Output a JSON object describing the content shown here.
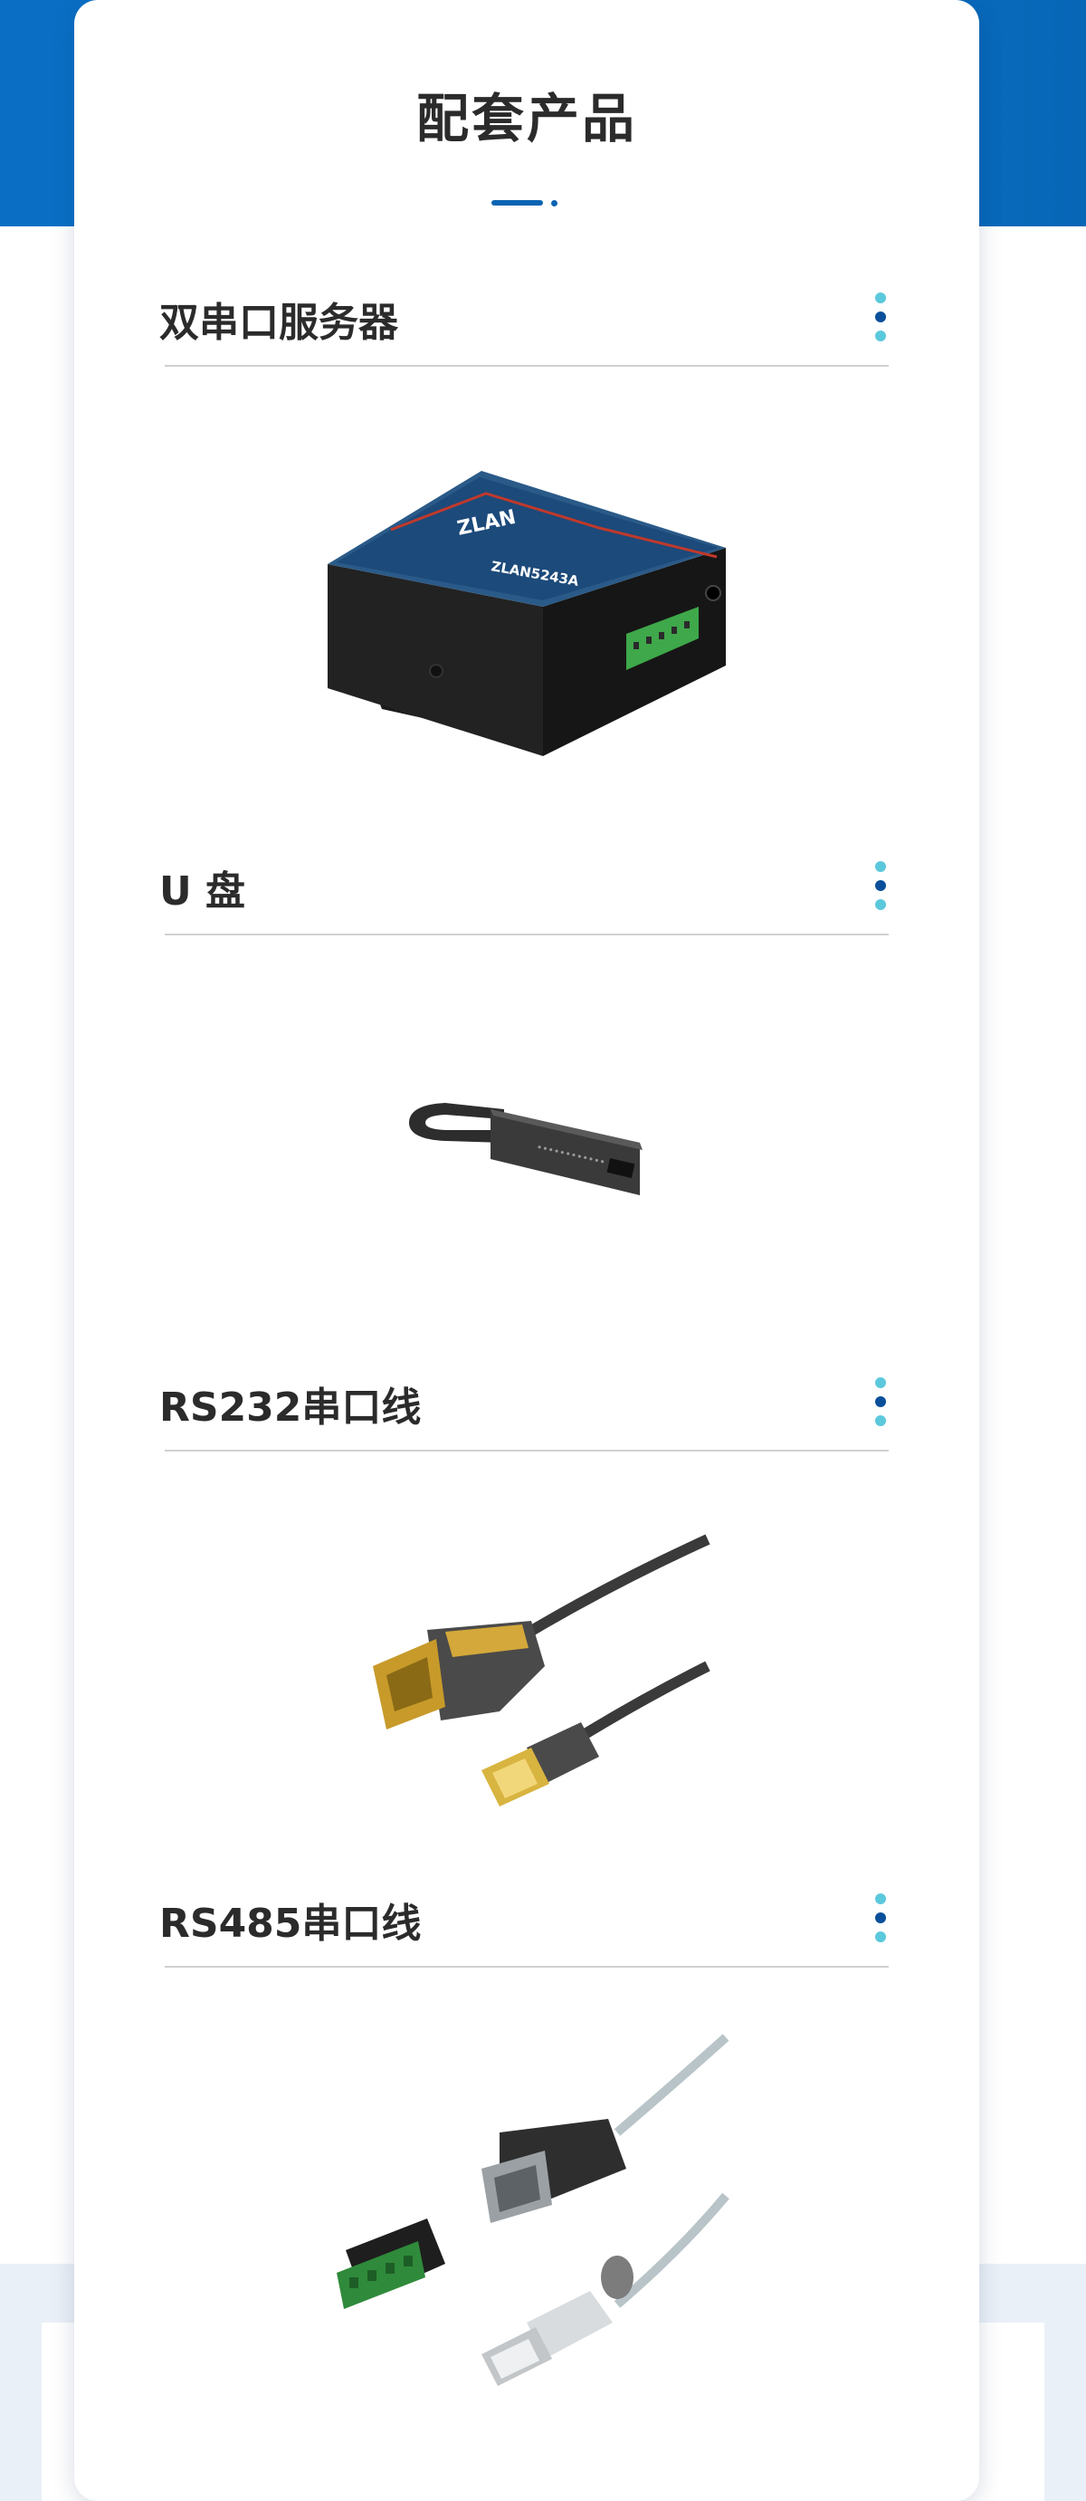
{
  "page": {
    "title": "配套产品"
  },
  "colors": {
    "header_blue": "#0a6fc4",
    "accent_navy": "#0a4f9a",
    "accent_cyan": "#5cc8dc",
    "divider": "#d0d0d0"
  },
  "products": [
    {
      "title": "双串口服务器",
      "image": "dual-serial-server-image"
    },
    {
      "title": "U 盘",
      "image": "usb-flash-drive-image"
    },
    {
      "title": "RS232串口线",
      "image": "rs232-cable-image"
    },
    {
      "title": "RS485串口线",
      "image": "rs485-cable-image"
    }
  ],
  "server_label": {
    "brand": "ZLAN",
    "model": "ZLAN5243A"
  }
}
